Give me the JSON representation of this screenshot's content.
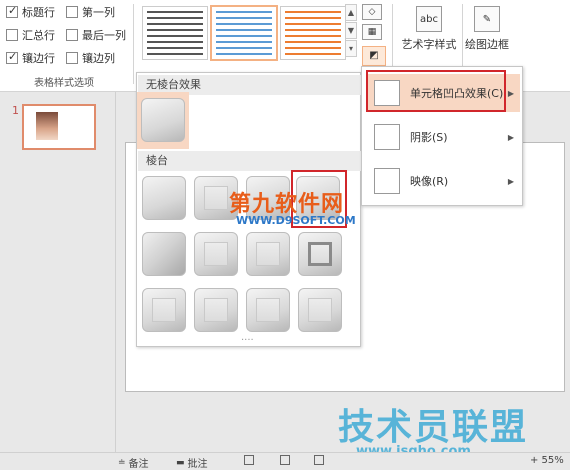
{
  "ribbon": {
    "options": {
      "header_row": "标题行",
      "first_column": "第一列",
      "total_row": "汇总行",
      "last_column": "最后一列",
      "banded_rows": "镶边行",
      "banded_columns": "镶边列",
      "group_label": "表格样式选项"
    },
    "buttons": {
      "wordart": "艺术字样式",
      "wordart_icon": "abc",
      "draw_borders": "绘图边框"
    }
  },
  "slide_panel": {
    "slide_number": "1"
  },
  "dropdown": {
    "no_bevel_label": "无棱台效果",
    "bevel_label": "棱台",
    "more_dots": "····"
  },
  "submenu": {
    "items": [
      {
        "label": "单元格凹凸效果(C)"
      },
      {
        "label": "阴影(S)"
      },
      {
        "label": "映像(R)"
      }
    ]
  },
  "statusbar": {
    "notes": "备注",
    "comments": "批注",
    "zoom_partial": "+ 55%"
  },
  "watermarks": {
    "top_cn": "第九软件网",
    "top_en": "WWW.D9SOFT.COM",
    "bottom_cn": "技术员联盟",
    "bottom_en": "www.jsgho.com"
  },
  "colors": {
    "highlight": "#f8d7c3",
    "red_border": "#d1262b",
    "thumb_border": "#e08b6b"
  }
}
